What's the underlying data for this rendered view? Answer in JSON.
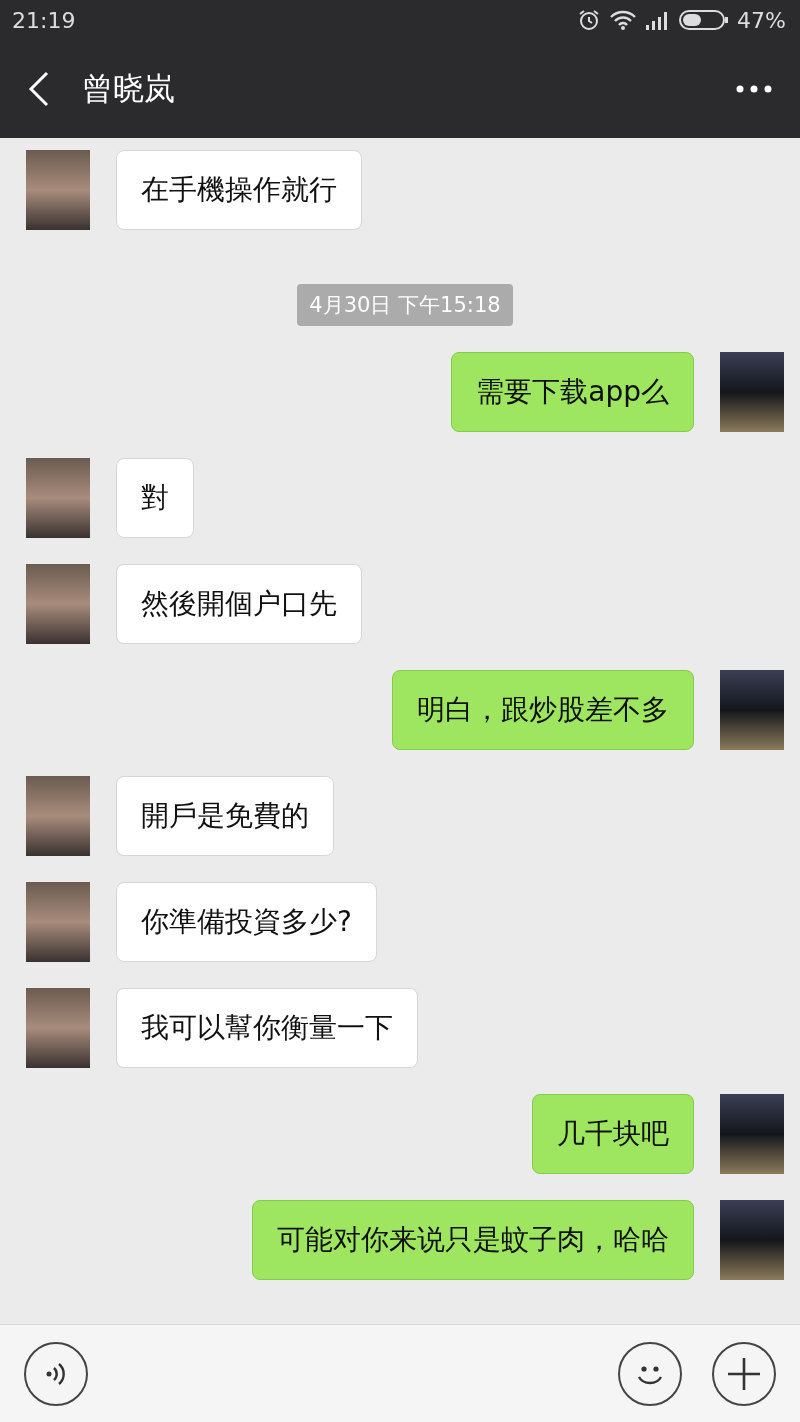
{
  "status_bar": {
    "time": "21:19",
    "battery": "47%"
  },
  "header": {
    "title": "曾晓岚"
  },
  "messages": [
    {
      "kind": "incoming",
      "text": "在手機操作就行"
    },
    {
      "kind": "time",
      "text": "4月30日 下午15:18"
    },
    {
      "kind": "outgoing",
      "text": "需要下载app么"
    },
    {
      "kind": "incoming",
      "text": "對"
    },
    {
      "kind": "incoming",
      "text": "然後開個户口先"
    },
    {
      "kind": "outgoing",
      "text": "明白，跟炒股差不多"
    },
    {
      "kind": "incoming",
      "text": "開戶是免費的"
    },
    {
      "kind": "incoming",
      "text": "你準備投資多少?"
    },
    {
      "kind": "incoming",
      "text": "我可以幫你衡量一下"
    },
    {
      "kind": "outgoing",
      "text": "几千块吧"
    },
    {
      "kind": "outgoing",
      "text": "可能对你来说只是蚊子肉，哈哈"
    }
  ]
}
